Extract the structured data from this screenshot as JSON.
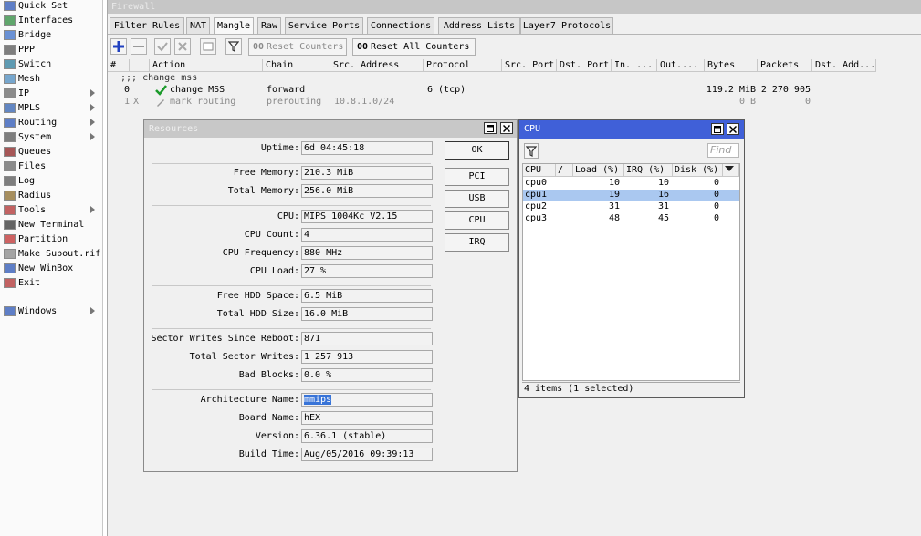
{
  "sidebar": {
    "items": [
      {
        "label": "Quick Set",
        "icon": "quick-set-icon",
        "submenu": false
      },
      {
        "label": "Interfaces",
        "icon": "interfaces-icon",
        "submenu": false
      },
      {
        "label": "Bridge",
        "icon": "bridge-icon",
        "submenu": false
      },
      {
        "label": "PPP",
        "icon": "ppp-icon",
        "submenu": false
      },
      {
        "label": "Switch",
        "icon": "switch-icon",
        "submenu": false
      },
      {
        "label": "Mesh",
        "icon": "mesh-icon",
        "submenu": false
      },
      {
        "label": "IP",
        "icon": "ip-icon",
        "submenu": true
      },
      {
        "label": "MPLS",
        "icon": "mpls-icon",
        "submenu": true
      },
      {
        "label": "Routing",
        "icon": "routing-icon",
        "submenu": true
      },
      {
        "label": "System",
        "icon": "system-icon",
        "submenu": true
      },
      {
        "label": "Queues",
        "icon": "queues-icon",
        "submenu": false
      },
      {
        "label": "Files",
        "icon": "files-icon",
        "submenu": false
      },
      {
        "label": "Log",
        "icon": "log-icon",
        "submenu": false
      },
      {
        "label": "Radius",
        "icon": "radius-icon",
        "submenu": false
      },
      {
        "label": "Tools",
        "icon": "tools-icon",
        "submenu": true
      },
      {
        "label": "New Terminal",
        "icon": "terminal-icon",
        "submenu": false
      },
      {
        "label": "Partition",
        "icon": "partition-icon",
        "submenu": false
      },
      {
        "label": "Make Supout.rif",
        "icon": "supout-icon",
        "submenu": false
      },
      {
        "label": "New WinBox",
        "icon": "winbox-icon",
        "submenu": false
      },
      {
        "label": "Exit",
        "icon": "exit-icon",
        "submenu": false
      },
      {
        "label": "Windows",
        "icon": "windows-icon",
        "submenu": true
      }
    ]
  },
  "firewall": {
    "title": "Firewall",
    "tabs": [
      "Filter Rules",
      "NAT",
      "Mangle",
      "Raw",
      "Service Ports",
      "Connections",
      "Address Lists",
      "Layer7 Protocols"
    ],
    "active_tab": "Mangle",
    "toolbar": {
      "reset_counters": "Reset Counters",
      "reset_all_counters": "Reset All Counters",
      "counter_glyph": "00"
    },
    "columns": [
      "#",
      "",
      "Action",
      "Chain",
      "Src. Address",
      "Protocol",
      "Src. Port",
      "Dst. Port",
      "In. ...",
      "Out....",
      "Bytes",
      "Packets",
      "Dst. Add..."
    ],
    "comment": ";;; change mss",
    "rows": [
      {
        "num": "0",
        "flag": "",
        "action": "change MSS",
        "chain": "forward",
        "src": "",
        "protocol": "6 (tcp)",
        "bytes": "119.2 MiB",
        "packets": "2 270 905",
        "disabled": false
      },
      {
        "num": "1",
        "flag": "X",
        "action": "mark routing",
        "chain": "prerouting",
        "src": "10.8.1.0/24",
        "protocol": "",
        "bytes": "0 B",
        "packets": "0",
        "disabled": true
      }
    ]
  },
  "resources": {
    "title": "Resources",
    "fields": {
      "uptime": {
        "label": "Uptime:",
        "value": "6d 04:45:18"
      },
      "free_memory": {
        "label": "Free Memory:",
        "value": "210.3 MiB"
      },
      "total_memory": {
        "label": "Total Memory:",
        "value": "256.0 MiB"
      },
      "cpu": {
        "label": "CPU:",
        "value": "MIPS 1004Kc V2.15"
      },
      "cpu_count": {
        "label": "CPU Count:",
        "value": "4"
      },
      "cpu_frequency": {
        "label": "CPU Frequency:",
        "value": "880 MHz"
      },
      "cpu_load": {
        "label": "CPU Load:",
        "value": "27 %"
      },
      "free_hdd": {
        "label": "Free HDD Space:",
        "value": "6.5 MiB"
      },
      "total_hdd": {
        "label": "Total HDD Size:",
        "value": "16.0 MiB"
      },
      "sector_writes_reboot": {
        "label": "Sector Writes Since Reboot:",
        "value": "871"
      },
      "total_sector_writes": {
        "label": "Total Sector Writes:",
        "value": "1 257 913"
      },
      "bad_blocks": {
        "label": "Bad Blocks:",
        "value": "0.0 %"
      },
      "architecture": {
        "label": "Architecture Name:",
        "value": "mmips"
      },
      "board_name": {
        "label": "Board Name:",
        "value": "hEX"
      },
      "version": {
        "label": "Version:",
        "value": "6.36.1 (stable)"
      },
      "build_time": {
        "label": "Build Time:",
        "value": "Aug/05/2016 09:39:13"
      }
    },
    "buttons": {
      "ok": "OK",
      "pci": "PCI",
      "usb": "USB",
      "cpu": "CPU",
      "irq": "IRQ"
    }
  },
  "cpu_window": {
    "title": "CPU",
    "find_placeholder": "Find",
    "columns": [
      "CPU",
      "/",
      "Load (%)",
      "IRQ (%)",
      "Disk (%)"
    ],
    "rows": [
      {
        "cpu": "cpu0",
        "load": "10",
        "irq": "10",
        "disk": "0",
        "selected": false
      },
      {
        "cpu": "cpu1",
        "load": "19",
        "irq": "16",
        "disk": "0",
        "selected": true
      },
      {
        "cpu": "cpu2",
        "load": "31",
        "irq": "31",
        "disk": "0",
        "selected": false
      },
      {
        "cpu": "cpu3",
        "load": "48",
        "irq": "45",
        "disk": "0",
        "selected": false
      }
    ],
    "status": "4 items (1 selected)"
  },
  "colors": {
    "accent_title": "#4060d8",
    "selection": "#aac8f0",
    "text_selection": "#3874d8"
  }
}
